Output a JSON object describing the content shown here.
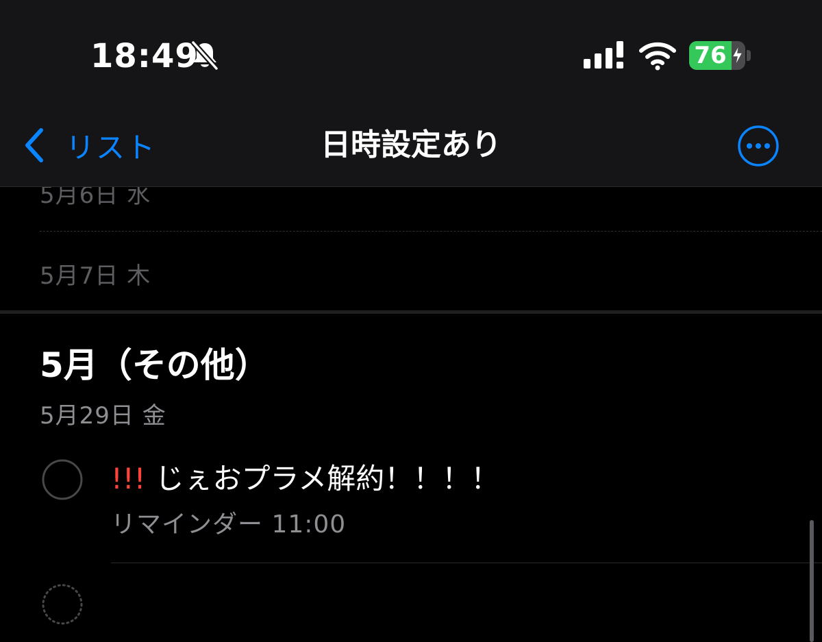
{
  "status_bar": {
    "time": "18:49",
    "battery_level": "76",
    "battery_fraction": 0.76,
    "icons": [
      "bell-slash-icon",
      "cellular-signal-icon",
      "wifi-icon",
      "battery-icon",
      "charging-bolt-icon"
    ]
  },
  "nav": {
    "back_label": "リスト",
    "title": "日時設定あり",
    "more_icon": "ellipsis-circle-icon"
  },
  "days_above": [
    {
      "label": "5月6日 水"
    },
    {
      "label": "5月7日 木"
    }
  ],
  "section": {
    "title": "5月（その他）",
    "date": "5月29日 金"
  },
  "reminder": {
    "priority": "!!!",
    "title": "じぇおプラメ解約！！！！",
    "subtitle": "リマインダー 11:00"
  },
  "colors": {
    "accent": "#0a84ff",
    "priority": "#ff453a",
    "battery": "#34c759",
    "background": "#000000",
    "header_background": "#151517"
  }
}
